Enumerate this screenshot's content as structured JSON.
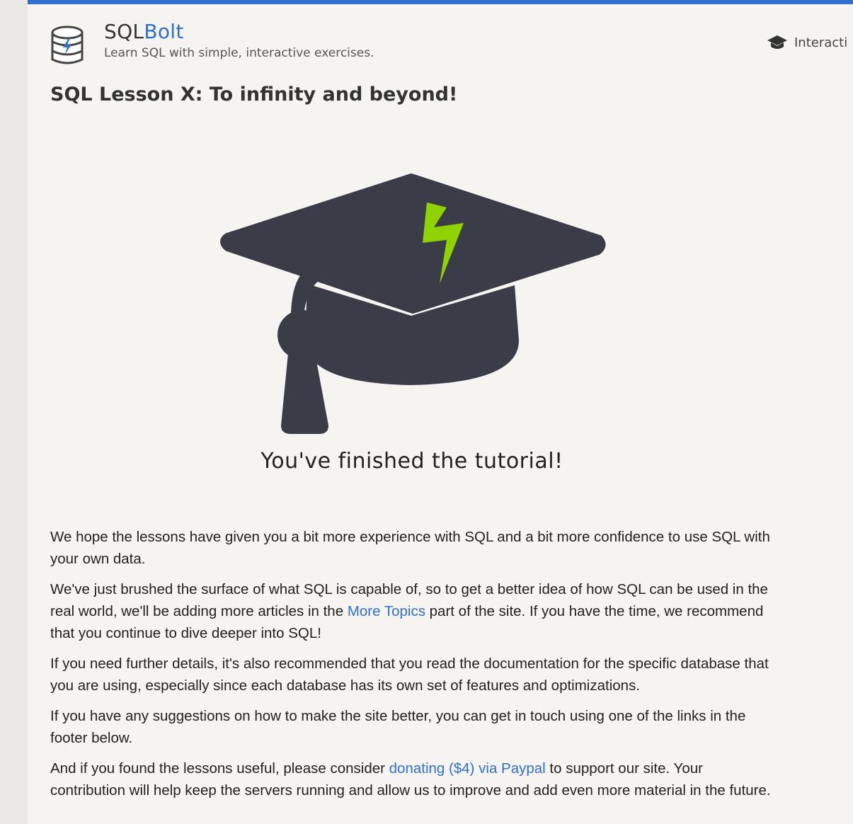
{
  "header": {
    "brand_main": "SQL",
    "brand_accent": "Bolt",
    "tagline": "Learn SQL with simple, interactive exercises.",
    "nav_label": "Interacti"
  },
  "lesson": {
    "title": "SQL Lesson X: To infinity and beyond!",
    "finished": "You've finished the tutorial!"
  },
  "paragraphs": {
    "p1": "We hope the lessons have given you a bit more experience with SQL and a bit more confidence to use SQL with your own data.",
    "p2_before": "We've just brushed the surface of what SQL is capable of, so to get a better idea of how SQL can be used in the real world, we'll be adding more articles in the ",
    "p2_link": "More Topics",
    "p2_after": " part of the site. If you have the time, we recommend that you continue to dive deeper into SQL!",
    "p3": "If you need further details, it's also recommended that you read the documentation for the specific database that you are using, especially since each database has its own set of features and optimizations.",
    "p4": "If you have any suggestions on how to make the site better, you can get in touch using one of the links in the footer below.",
    "p5_before": "And if you found the lessons useful, please consider ",
    "p5_link": "donating ($4) via Paypal",
    "p5_after": " to support our site. Your contribution will help keep the servers running and allow us to improve and add even more material in the future."
  },
  "icons": {
    "logo": "database-bolt-icon",
    "nav": "graduation-cap-icon",
    "hero": "graduation-cap-bolt-icon"
  },
  "colors": {
    "accent": "#2f6fd1",
    "cap": "#3a3d47",
    "bolt": "#8fd400"
  }
}
